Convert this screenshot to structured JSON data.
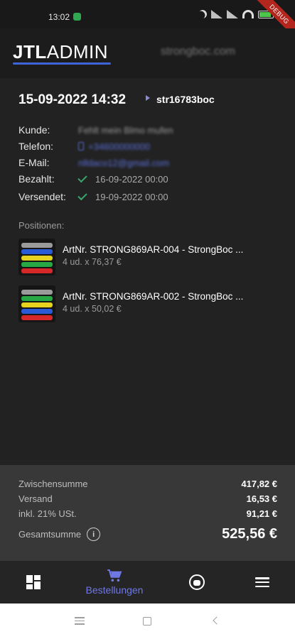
{
  "status_bar": {
    "time": "13:02",
    "debug_label": "DEBUG"
  },
  "app_bar": {
    "logo_bold": "JTL",
    "logo_regular": "ADMIN",
    "shop_name": "strongboc.com",
    "accent_color": "#3d64d8"
  },
  "order": {
    "date": "15-09-2022 14:32",
    "number": "str16783boc",
    "fields": [
      {
        "label": "Kunde:",
        "value": "Fehlt mein Blmo mufen",
        "blurred": true
      },
      {
        "label": "Telefon:",
        "value": "+34600000000",
        "blurred": true,
        "icon": "phone-icon"
      },
      {
        "label": "E-Mail:",
        "value": "nlldaco12@gmail.com",
        "blurred": true
      },
      {
        "label": "Bezahlt:",
        "value": "16-09-2022 00:00",
        "icon": "check-icon"
      },
      {
        "label": "Versendet:",
        "value": "19-09-2022 00:00",
        "icon": "check-icon"
      }
    ],
    "positions_title": "Positionen:",
    "positions": [
      {
        "title": "ArtNr. STRONG869AR-004 - StrongBoc ...",
        "subtitle": "4 ud. x 76,37 €"
      },
      {
        "title": "ArtNr. STRONG869AR-002 - StrongBoc ...",
        "subtitle": "4 ud. x 50,02 €"
      }
    ]
  },
  "summary": {
    "subtotal_label": "Zwischensumme",
    "subtotal_value": "417,82 €",
    "shipping_label": "Versand",
    "shipping_value": "16,53 €",
    "tax_label": "inkl. 21% USt.",
    "tax_value": "91,21 €",
    "total_label": "Gesamtsumme",
    "total_value": "525,56 €"
  },
  "bottom_nav": {
    "items": [
      {
        "icon": "dashboard-icon",
        "label": ""
      },
      {
        "icon": "cart-icon",
        "label": "Bestellungen",
        "active": true
      },
      {
        "icon": "support-icon",
        "label": ""
      },
      {
        "icon": "menu-icon",
        "label": ""
      }
    ],
    "active_color": "#6f78e6"
  }
}
